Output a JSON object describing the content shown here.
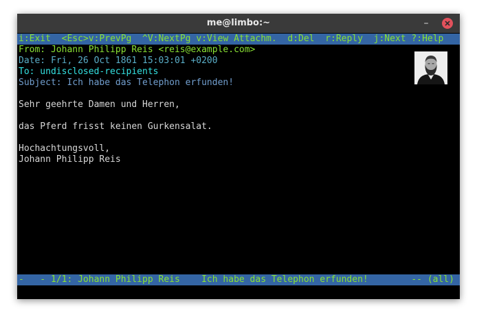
{
  "window": {
    "title": "me@limbo:~",
    "minimize_glyph": "–"
  },
  "help_bar": [
    {
      "key": "i",
      "label": "i:Exit"
    },
    {
      "key": "esc-v",
      "label": "<Esc>v:PrevPg"
    },
    {
      "key": "ctrl-v",
      "label": "^V:NextPg"
    },
    {
      "key": "v",
      "label": "v:View Attachm."
    },
    {
      "key": "d",
      "label": "d:Del"
    },
    {
      "key": "r",
      "label": "r:Reply"
    },
    {
      "key": "j",
      "label": "j:Next"
    },
    {
      "key": "help",
      "label": "?:Help"
    }
  ],
  "headers": {
    "from": "From: Johann Philipp Reis <reis@example.com>",
    "date": "Date: Fri, 26 Oct 1861 15:03:01 +0200",
    "to": "To: undisclosed-recipients",
    "subject": "Subject: Ich habe das Telephon erfunden!"
  },
  "body": {
    "greeting": "Sehr geehrte Damen und Herren,",
    "text": "das Pferd frisst keinen Gurkensalat.",
    "closing": "Hochachtungsvoll,",
    "signature": "Johann Philipp Reis"
  },
  "status_bar": {
    "text": "-   - 1/1: Johann Philipp Reis    Ich habe das Telephon erfunden!        -- (all)"
  },
  "colors": {
    "terminal_bg": "#000000",
    "bar_bg": "#3465a4",
    "green": "#8ae234",
    "cyan": "#34e2e2",
    "light_blue": "#729fcf",
    "close_button": "#e2515c"
  },
  "icons": {
    "close": "close-icon",
    "minimize": "minimize-icon",
    "sender_photo": "avatar"
  }
}
